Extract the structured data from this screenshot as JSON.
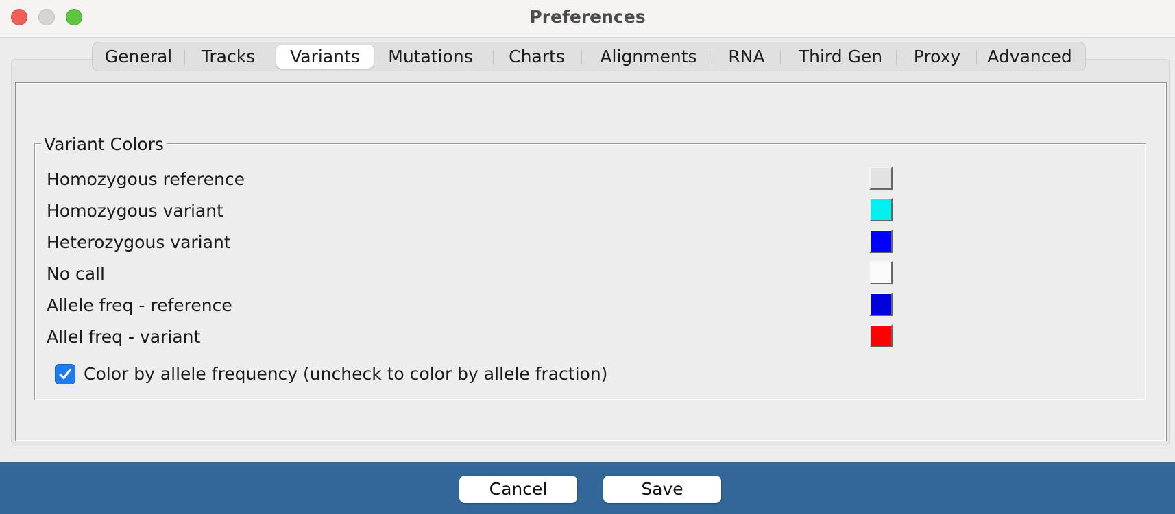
{
  "window": {
    "title": "Preferences"
  },
  "tabs": [
    {
      "label": "General"
    },
    {
      "label": "Tracks"
    },
    {
      "label": "Variants",
      "selected": true
    },
    {
      "label": "Mutations"
    },
    {
      "label": "Charts"
    },
    {
      "label": "Alignments"
    },
    {
      "label": "RNA"
    },
    {
      "label": "Third Gen"
    },
    {
      "label": "Proxy"
    },
    {
      "label": "Advanced"
    }
  ],
  "variant_colors": {
    "group_title": "Variant Colors",
    "rows": [
      {
        "label": "Homozygous reference",
        "color": "#e2e2e2"
      },
      {
        "label": "Homozygous variant",
        "color": "#00f0f0"
      },
      {
        "label": "Heterozygous variant",
        "color": "#0000ff"
      },
      {
        "label": "No call",
        "color": "#fafafa"
      },
      {
        "label": "Allele freq - reference",
        "color": "#0000dc"
      },
      {
        "label": "Allel freq - variant",
        "color": "#ff0000"
      }
    ],
    "allele_frequency_checkbox": {
      "label": "Color by allele frequency (uncheck to color by allele fraction)",
      "checked": true
    }
  },
  "buttons": {
    "cancel_label": "Cancel",
    "save_label": "Save"
  },
  "colors": {
    "footer_bg": "#336699",
    "checkbox_accent": "#1f7bf2"
  }
}
